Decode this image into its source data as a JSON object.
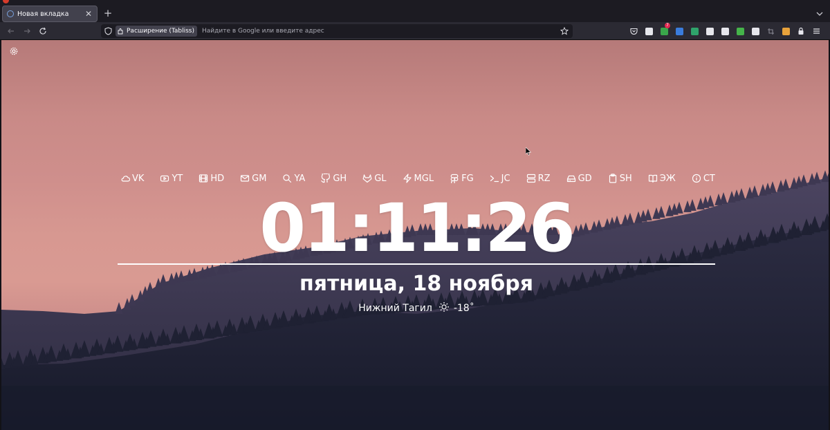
{
  "browser": {
    "tab": {
      "title": "Новая вкладка",
      "close_glyph": "✕"
    },
    "new_tab_glyph": "+",
    "urlbar": {
      "extension_label": "Расширение (Tabliss)",
      "placeholder": "Найдите в Google или введите адрес"
    },
    "toolbar_extensions": [
      {
        "name": "pocket-icon",
        "color": "#e6e6ec"
      },
      {
        "name": "globe-icon",
        "color": "#e6e6ec"
      },
      {
        "name": "addon-badge-icon",
        "color": "#3aa64b",
        "badge": "7"
      },
      {
        "name": "shield-blue-icon",
        "color": "#3a7cdc"
      },
      {
        "name": "dollar-icon",
        "color": "#2fa36b"
      },
      {
        "name": "card-icon",
        "color": "#e6e6ec"
      },
      {
        "name": "bird-icon",
        "color": "#e6e6ec"
      },
      {
        "name": "shield-green-icon",
        "color": "#45b34a"
      },
      {
        "name": "picture-icon",
        "color": "#e6e6ec"
      },
      {
        "name": "crop-icon",
        "color": "#8a8a94"
      },
      {
        "name": "mascot-icon",
        "color": "#e8a23b"
      },
      {
        "name": "lock-icon",
        "color": "#e6e6ec"
      },
      {
        "name": "menu-icon",
        "color": "#e6e6ec"
      }
    ]
  },
  "page": {
    "links": [
      {
        "label": "VK",
        "icon": "cloud-icon"
      },
      {
        "label": "YT",
        "icon": "youtube-icon"
      },
      {
        "label": "HD",
        "icon": "film-icon"
      },
      {
        "label": "GM",
        "icon": "mail-icon"
      },
      {
        "label": "YA",
        "icon": "search-icon"
      },
      {
        "label": "GH",
        "icon": "github-icon"
      },
      {
        "label": "GL",
        "icon": "gitlab-icon"
      },
      {
        "label": "MGL",
        "icon": "zap-icon"
      },
      {
        "label": "FG",
        "icon": "figma-icon"
      },
      {
        "label": "JC",
        "icon": "terminal-icon"
      },
      {
        "label": "RZ",
        "icon": "server-icon"
      },
      {
        "label": "GD",
        "icon": "hard-drive-icon"
      },
      {
        "label": "SH",
        "icon": "clipboard-icon"
      },
      {
        "label": "ЭЖ",
        "icon": "book-icon"
      },
      {
        "label": "CT",
        "icon": "info-icon"
      }
    ],
    "clock": "01:11:26",
    "date": "пятница, 18 ноября",
    "weather": {
      "city": "Нижний Тагил",
      "temperature": "-18˚",
      "icon": "sun-icon"
    }
  },
  "colors": {
    "sky_top": "#b67a79",
    "sky_mid": "#d79891",
    "mountain_far": "#3f3a52",
    "mountain_near": "#232437",
    "text": "#ffffff"
  }
}
